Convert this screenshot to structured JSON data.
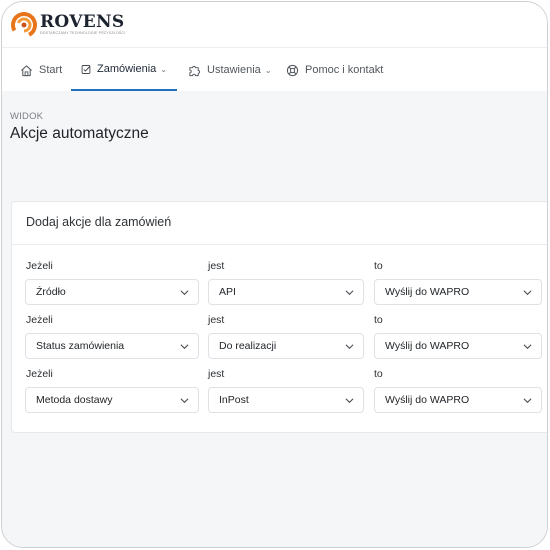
{
  "brand": {
    "name": "ROVENS",
    "tagline": "DOSTARCZAMY TECHNOLOGIE PRZYSZŁOŚCI",
    "colors": {
      "orange": "#e8751a",
      "dark": "#1d2430"
    }
  },
  "nav": {
    "items": [
      {
        "label": "Start",
        "icon": "home-icon"
      },
      {
        "label": "Zamówienia",
        "icon": "checkbox-icon",
        "active": true,
        "dropdown": true
      },
      {
        "label": "Ustawienia",
        "icon": "puzzle-icon",
        "dropdown": true
      },
      {
        "label": "Pomoc i kontakt",
        "icon": "lifebuoy-icon"
      }
    ],
    "accent": "#1f6fbf"
  },
  "page": {
    "breadcrumb": "WIDOK",
    "title": "Akcje automatyczne"
  },
  "card": {
    "title": "Dodaj akcje dla zamówień",
    "rows": [
      {
        "if_label": "Jeżeli",
        "field": "Źródło",
        "is_label": "jest",
        "value": "API",
        "to_label": "to",
        "action": "Wyślij do WAPRO"
      },
      {
        "if_label": "Jeżeli",
        "field": "Status zamówienia",
        "is_label": "jest",
        "value": "Do realizacji",
        "to_label": "to",
        "action": "Wyślij do WAPRO"
      },
      {
        "if_label": "Jeżeli",
        "field": "Metoda dostawy",
        "is_label": "jest",
        "value": "InPost",
        "to_label": "to",
        "action": "Wyślij do WAPRO"
      }
    ]
  }
}
